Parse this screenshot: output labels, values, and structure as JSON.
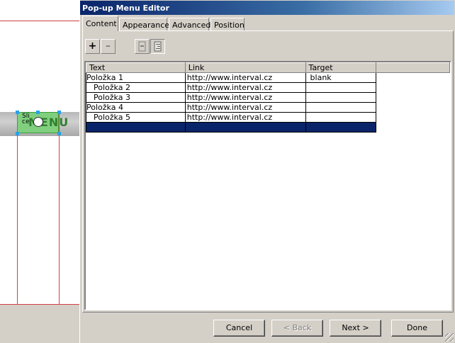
{
  "canvas": {
    "slice_label": "Sli\nce",
    "slice_text": "MENU"
  },
  "dialog": {
    "title": "Pop-up Menu Editor",
    "tabs": [
      {
        "label": "Content",
        "active": true
      },
      {
        "label": "Appearance",
        "active": false
      },
      {
        "label": "Advanced",
        "active": false
      },
      {
        "label": "Position",
        "active": false
      }
    ],
    "toolbar": {
      "add": "+",
      "remove": "–",
      "outdent": "indent-left-icon",
      "indent": "indent-right-icon"
    },
    "table": {
      "columns": [
        "Text",
        "Link",
        "Target",
        ""
      ],
      "rows": [
        {
          "text": "Položka 1",
          "link": "http://www.interval.cz",
          "target": "blank",
          "level": 0
        },
        {
          "text": "Položka 2",
          "link": "http://www.interval.cz",
          "target": "",
          "level": 1
        },
        {
          "text": "Položka 3",
          "link": "http://www.interval.cz",
          "target": "",
          "level": 1
        },
        {
          "text": "Položka 4",
          "link": "http://www.interval.cz",
          "target": "",
          "level": 0
        },
        {
          "text": "Položka 5",
          "link": "http://www.interval.cz",
          "target": "",
          "level": 1
        },
        {
          "text": "",
          "link": "",
          "target": "",
          "level": 0,
          "selected": true
        }
      ]
    },
    "buttons": {
      "cancel": "Cancel",
      "back": "< Back",
      "next": "Next >",
      "done": "Done"
    }
  },
  "colors": {
    "titlebar": "#0a246a",
    "selection": "#0a246a",
    "face": "#d4d0c8",
    "guide": "#d04040",
    "slice": "#7fcf7f"
  }
}
